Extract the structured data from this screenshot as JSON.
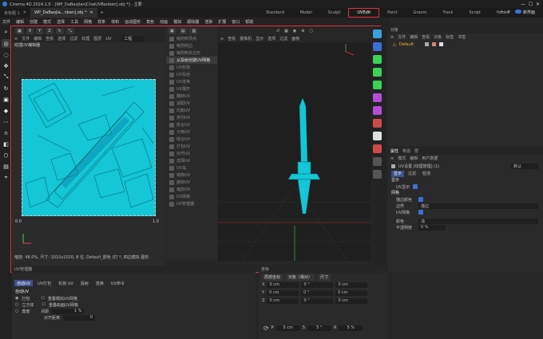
{
  "app": {
    "title": "Cinema 4D 2024.1.0 - [WP_DaBaoJian|ChaiUVBanben].obj *] - 主要"
  },
  "doc_tabs": [
    {
      "label": "未标题 1"
    },
    {
      "label": "WP_DaBaoJia...nben].obj *"
    }
  ],
  "layout_tabs": [
    "Standard",
    "Model",
    "Sculpt",
    "UVEdit",
    "Paint",
    "Groom",
    "Track",
    "Script",
    "Nodes"
  ],
  "active_layout": "UVEdit",
  "new_interface": "新界面",
  "menu": [
    "文件",
    "编辑",
    "创建",
    "模式",
    "选择",
    "工具",
    "网格",
    "样条",
    "体积",
    "运动图形",
    "角色",
    "动画",
    "模拟",
    "跟踪器",
    "渲染",
    "扩展",
    "窗口",
    "帮助"
  ],
  "uv_panel": {
    "menu": [
      "文件",
      "编辑",
      "查看",
      "选择",
      "过滤",
      "纹理",
      "图层",
      "UV",
      "工程"
    ],
    "channel": "工程",
    "title": "纹理UV编辑器",
    "axis_0": "0.0",
    "axis_1": "1.0",
    "status": "缩放: 48.0%, 尺寸: 1010x1020, 8 位, Default_颜色 (打 *, 四边模拟 图形"
  },
  "uv_commands": [
    {
      "label": "吸附到顶点"
    },
    {
      "label": "吸附到边"
    },
    {
      "label": "吸附到多边形"
    },
    {
      "label": "从投射创建UV网格",
      "hi": true
    },
    {
      "label": "UV松弛"
    },
    {
      "label": "UV投射"
    },
    {
      "label": "UV变换"
    },
    {
      "label": "UV展开"
    },
    {
      "label": "翻转UV"
    },
    {
      "label": "适配UV"
    },
    {
      "label": "均衡UV"
    },
    {
      "label": "排列UV"
    },
    {
      "label": "拼合UV"
    },
    {
      "label": "分离UV"
    },
    {
      "label": "缝合UV"
    },
    {
      "label": "打包UV"
    },
    {
      "label": "对齐UV"
    },
    {
      "label": "选择UV"
    },
    {
      "label": "UV岛"
    },
    {
      "label": "镜像UV"
    },
    {
      "label": "旋转UV"
    },
    {
      "label": "缩放UV"
    },
    {
      "label": "UV网格"
    },
    {
      "label": "UV管理器"
    }
  ],
  "viewport": {
    "menu": [
      "查看",
      "摄像机",
      "显示",
      "选项",
      "过滤",
      "面板"
    ]
  },
  "objects_panel": {
    "title": "对象",
    "menu": [
      "文件",
      "编辑",
      "查看",
      "对象",
      "标签",
      "书签"
    ],
    "item": "Default"
  },
  "attributes": {
    "tabs": [
      "属性",
      "构造",
      "层"
    ],
    "menu": [
      "模式",
      "编辑",
      "用户数据"
    ],
    "object_title": "UV设置 [纹理管理] (1)",
    "preset": "默认",
    "subtabs": [
      "显示",
      "过滤",
      "检测"
    ],
    "section_display": "显示",
    "uv_display": "UV显示",
    "section_mesh": "网格",
    "fill_label": "描边颜色",
    "boundary_label": "边界",
    "boundary_value": "描边",
    "uv_mesh_label": "UV网格",
    "color_label": "颜色",
    "color_value": "浅",
    "opacity_label": "不透明度",
    "opacity_value": "0 %"
  },
  "uv_manager": {
    "title": "UV管理器",
    "tabs": [
      "自动UV",
      "UV打包",
      "松弛 UV",
      "投射",
      "变换",
      "UV命令"
    ],
    "section": "自动UV",
    "options": [
      "打包",
      "立方体",
      "角度"
    ],
    "opt1": "重叠模拟UV网格",
    "opt2": "重叠曲面UV网格",
    "spacing_label": "间距",
    "spacing_value": "1 %",
    "realign_label": "对齐距离",
    "realign_value": "0"
  },
  "coords": {
    "title": "坐标",
    "buttons": [
      "局部坐标",
      "对象（相对）",
      "尺寸"
    ],
    "rows": [
      {
        "axis": "X",
        "v1": "0 cm",
        "v2": "0 °",
        "v3": "0 cm"
      },
      {
        "axis": "Y",
        "v1": "0 cm",
        "v2": "0 °",
        "v3": "0 cm"
      },
      {
        "axis": "Z",
        "v1": "0 cm",
        "v2": "0 °",
        "v3": "0 cm"
      }
    ],
    "bottom": [
      {
        "axis": "P",
        "value": "5 cm"
      },
      {
        "axis": "S",
        "value": "5 °"
      },
      {
        "axis": "R",
        "value": "5 %"
      }
    ]
  },
  "colors": {
    "uv_fill": "#14c6d6",
    "accent": "#3d6fd8",
    "highlight": "#e0303a"
  }
}
